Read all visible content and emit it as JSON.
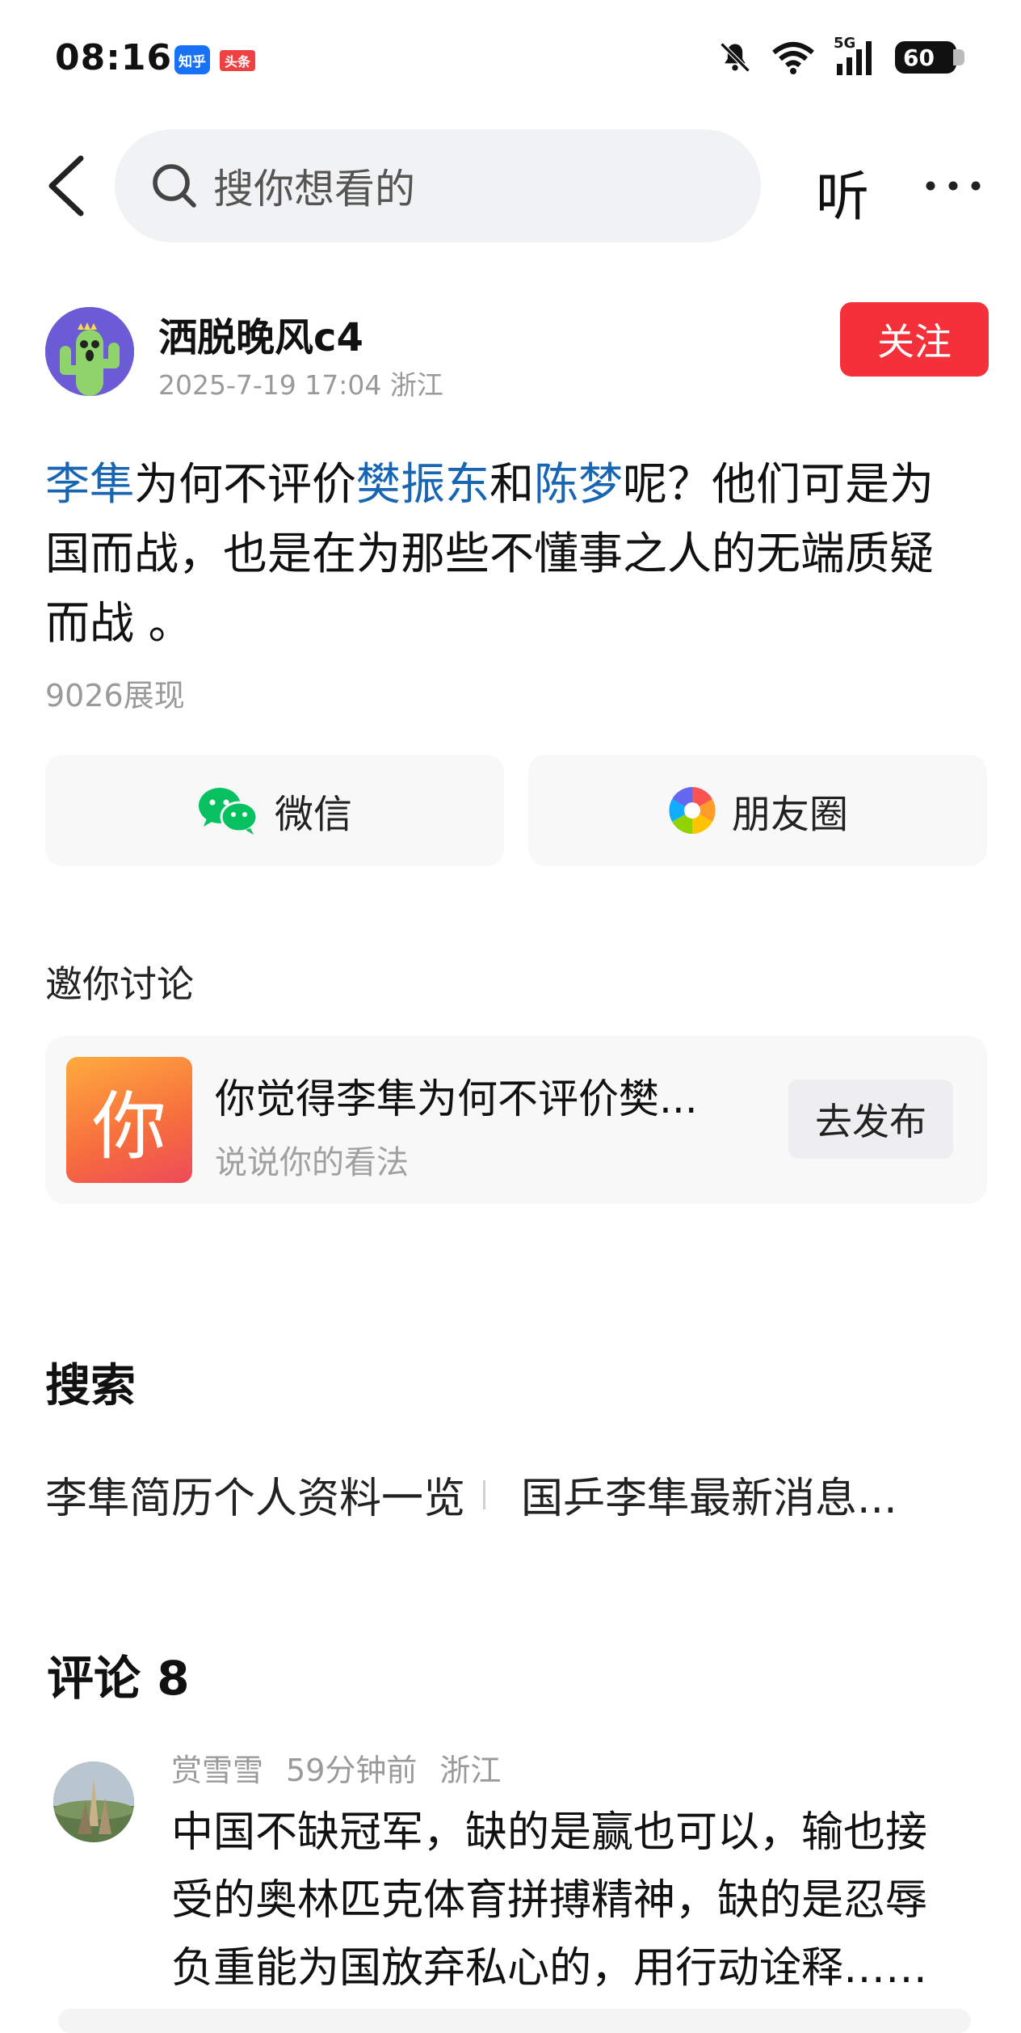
{
  "status_bar": {
    "time": "08:16",
    "app_badges": [
      "知乎",
      "头条"
    ],
    "network": "5G",
    "battery": "60"
  },
  "nav": {
    "search_placeholder": "搜你想看的",
    "listen_label": "听"
  },
  "author": {
    "name": "洒脱晚风c4",
    "meta": "2025-7-19 17:04 浙江",
    "follow_label": "关注"
  },
  "post": {
    "segments": [
      {
        "text": "李隼",
        "link": true
      },
      {
        "text": "为何不评价",
        "link": false
      },
      {
        "text": "樊振东",
        "link": true
      },
      {
        "text": "和",
        "link": false
      },
      {
        "text": "陈梦",
        "link": true
      },
      {
        "text": "呢？他们可是为国而战，也是在为那些不懂事之人的无端质疑而战 。",
        "link": false
      }
    ],
    "views": "9026展现"
  },
  "share": {
    "wechat_label": "微信",
    "moments_label": "朋友圈"
  },
  "invite": {
    "heading": "邀你讨论",
    "thumb_char": "你",
    "title": "你觉得李隼为何不评价樊...",
    "subtitle": "说说你的看法",
    "publish_label": "去发布"
  },
  "search_section": {
    "heading": "搜索",
    "links": [
      "李隼简历个人资料一览",
      "国乒李隼最新消息..."
    ]
  },
  "comments": {
    "heading": "评论 8",
    "items": [
      {
        "user": "赏雪雪",
        "time": "59分钟前",
        "location": "浙江",
        "text": "中国不缺冠军，缺的是赢也可以，输也接受的奥林匹克体育拼搏精神，缺的是忍辱负重能为国放弃私心的，用行动诠释……"
      }
    ]
  },
  "colors": {
    "link": "#1865b3",
    "follow": "#f4313b",
    "wechat_green": "#07c160"
  }
}
